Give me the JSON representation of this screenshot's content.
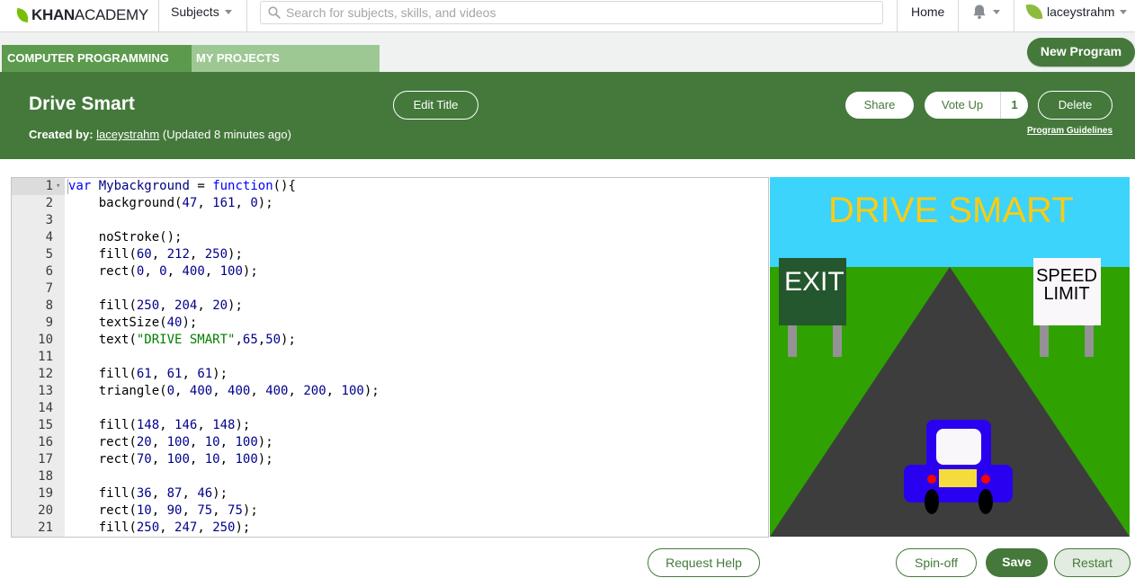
{
  "nav": {
    "logo_bold": "KHAN",
    "logo_light": "ACADEMY",
    "subjects_label": "Subjects",
    "search_placeholder": "Search for subjects, skills, and videos",
    "home_label": "Home",
    "username": "laceystrahm"
  },
  "tabs": {
    "computer_programming": "COMPUTER PROGRAMMING",
    "my_projects": "MY PROJECTS",
    "new_program": "New Program"
  },
  "header": {
    "title": "Drive Smart",
    "created_by_label": "Created by:",
    "author": "laceystrahm",
    "updated": "(Updated 8 minutes ago)",
    "edit_title": "Edit Title",
    "share": "Share",
    "vote_up": "Vote Up",
    "vote_count": "1",
    "delete": "Delete",
    "guidelines": "Program Guidelines"
  },
  "editor": {
    "lines": [
      "var Mybackground = function(){",
      "    background(47, 161, 0);",
      "",
      "    noStroke();",
      "    fill(60, 212, 250);",
      "    rect(0, 0, 400, 100);",
      "",
      "    fill(250, 204, 20);",
      "    textSize(40);",
      "    text(\"DRIVE SMART\",65,50);",
      "",
      "    fill(61, 61, 61);",
      "    triangle(0, 400, 400, 400, 200, 100);",
      "",
      "    fill(148, 146, 148);",
      "    rect(20, 100, 10, 100);",
      "    rect(70, 100, 10, 100);",
      "",
      "    fill(36, 87, 46);",
      "    rect(10, 90, 75, 75);",
      "    fill(250, 247, 250);"
    ]
  },
  "canvas": {
    "title": "DRIVE SMART",
    "exit_sign": "EXIT",
    "speed_line1": "SPEED",
    "speed_line2": "LIMIT",
    "colors": {
      "sky": "#3cd4fa",
      "grass": "#2fa100",
      "title": "#facc14",
      "road": "#3d3d3d",
      "post": "#949294",
      "exit_sign": "#24572e",
      "speed_sign": "#faf7fa",
      "car": "#2a00f0",
      "plate": "#f5dc3c",
      "light": "#ff0000"
    }
  },
  "footer": {
    "request_help": "Request Help",
    "spin_off": "Spin-off",
    "save": "Save",
    "restart": "Restart"
  }
}
